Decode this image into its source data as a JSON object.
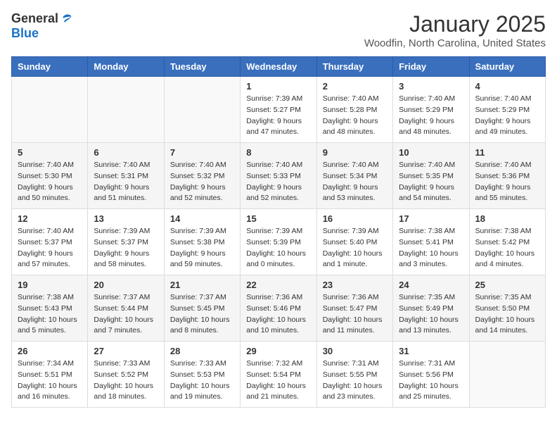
{
  "header": {
    "logo_general": "General",
    "logo_blue": "Blue",
    "month_title": "January 2025",
    "location": "Woodfin, North Carolina, United States"
  },
  "weekdays": [
    "Sunday",
    "Monday",
    "Tuesday",
    "Wednesday",
    "Thursday",
    "Friday",
    "Saturday"
  ],
  "weeks": [
    [
      {
        "day": "",
        "info": ""
      },
      {
        "day": "",
        "info": ""
      },
      {
        "day": "",
        "info": ""
      },
      {
        "day": "1",
        "info": "Sunrise: 7:39 AM\nSunset: 5:27 PM\nDaylight: 9 hours\nand 47 minutes."
      },
      {
        "day": "2",
        "info": "Sunrise: 7:40 AM\nSunset: 5:28 PM\nDaylight: 9 hours\nand 48 minutes."
      },
      {
        "day": "3",
        "info": "Sunrise: 7:40 AM\nSunset: 5:29 PM\nDaylight: 9 hours\nand 48 minutes."
      },
      {
        "day": "4",
        "info": "Sunrise: 7:40 AM\nSunset: 5:29 PM\nDaylight: 9 hours\nand 49 minutes."
      }
    ],
    [
      {
        "day": "5",
        "info": "Sunrise: 7:40 AM\nSunset: 5:30 PM\nDaylight: 9 hours\nand 50 minutes."
      },
      {
        "day": "6",
        "info": "Sunrise: 7:40 AM\nSunset: 5:31 PM\nDaylight: 9 hours\nand 51 minutes."
      },
      {
        "day": "7",
        "info": "Sunrise: 7:40 AM\nSunset: 5:32 PM\nDaylight: 9 hours\nand 52 minutes."
      },
      {
        "day": "8",
        "info": "Sunrise: 7:40 AM\nSunset: 5:33 PM\nDaylight: 9 hours\nand 52 minutes."
      },
      {
        "day": "9",
        "info": "Sunrise: 7:40 AM\nSunset: 5:34 PM\nDaylight: 9 hours\nand 53 minutes."
      },
      {
        "day": "10",
        "info": "Sunrise: 7:40 AM\nSunset: 5:35 PM\nDaylight: 9 hours\nand 54 minutes."
      },
      {
        "day": "11",
        "info": "Sunrise: 7:40 AM\nSunset: 5:36 PM\nDaylight: 9 hours\nand 55 minutes."
      }
    ],
    [
      {
        "day": "12",
        "info": "Sunrise: 7:40 AM\nSunset: 5:37 PM\nDaylight: 9 hours\nand 57 minutes."
      },
      {
        "day": "13",
        "info": "Sunrise: 7:39 AM\nSunset: 5:37 PM\nDaylight: 9 hours\nand 58 minutes."
      },
      {
        "day": "14",
        "info": "Sunrise: 7:39 AM\nSunset: 5:38 PM\nDaylight: 9 hours\nand 59 minutes."
      },
      {
        "day": "15",
        "info": "Sunrise: 7:39 AM\nSunset: 5:39 PM\nDaylight: 10 hours\nand 0 minutes."
      },
      {
        "day": "16",
        "info": "Sunrise: 7:39 AM\nSunset: 5:40 PM\nDaylight: 10 hours\nand 1 minute."
      },
      {
        "day": "17",
        "info": "Sunrise: 7:38 AM\nSunset: 5:41 PM\nDaylight: 10 hours\nand 3 minutes."
      },
      {
        "day": "18",
        "info": "Sunrise: 7:38 AM\nSunset: 5:42 PM\nDaylight: 10 hours\nand 4 minutes."
      }
    ],
    [
      {
        "day": "19",
        "info": "Sunrise: 7:38 AM\nSunset: 5:43 PM\nDaylight: 10 hours\nand 5 minutes."
      },
      {
        "day": "20",
        "info": "Sunrise: 7:37 AM\nSunset: 5:44 PM\nDaylight: 10 hours\nand 7 minutes."
      },
      {
        "day": "21",
        "info": "Sunrise: 7:37 AM\nSunset: 5:45 PM\nDaylight: 10 hours\nand 8 minutes."
      },
      {
        "day": "22",
        "info": "Sunrise: 7:36 AM\nSunset: 5:46 PM\nDaylight: 10 hours\nand 10 minutes."
      },
      {
        "day": "23",
        "info": "Sunrise: 7:36 AM\nSunset: 5:47 PM\nDaylight: 10 hours\nand 11 minutes."
      },
      {
        "day": "24",
        "info": "Sunrise: 7:35 AM\nSunset: 5:49 PM\nDaylight: 10 hours\nand 13 minutes."
      },
      {
        "day": "25",
        "info": "Sunrise: 7:35 AM\nSunset: 5:50 PM\nDaylight: 10 hours\nand 14 minutes."
      }
    ],
    [
      {
        "day": "26",
        "info": "Sunrise: 7:34 AM\nSunset: 5:51 PM\nDaylight: 10 hours\nand 16 minutes."
      },
      {
        "day": "27",
        "info": "Sunrise: 7:33 AM\nSunset: 5:52 PM\nDaylight: 10 hours\nand 18 minutes."
      },
      {
        "day": "28",
        "info": "Sunrise: 7:33 AM\nSunset: 5:53 PM\nDaylight: 10 hours\nand 19 minutes."
      },
      {
        "day": "29",
        "info": "Sunrise: 7:32 AM\nSunset: 5:54 PM\nDaylight: 10 hours\nand 21 minutes."
      },
      {
        "day": "30",
        "info": "Sunrise: 7:31 AM\nSunset: 5:55 PM\nDaylight: 10 hours\nand 23 minutes."
      },
      {
        "day": "31",
        "info": "Sunrise: 7:31 AM\nSunset: 5:56 PM\nDaylight: 10 hours\nand 25 minutes."
      },
      {
        "day": "",
        "info": ""
      }
    ]
  ]
}
